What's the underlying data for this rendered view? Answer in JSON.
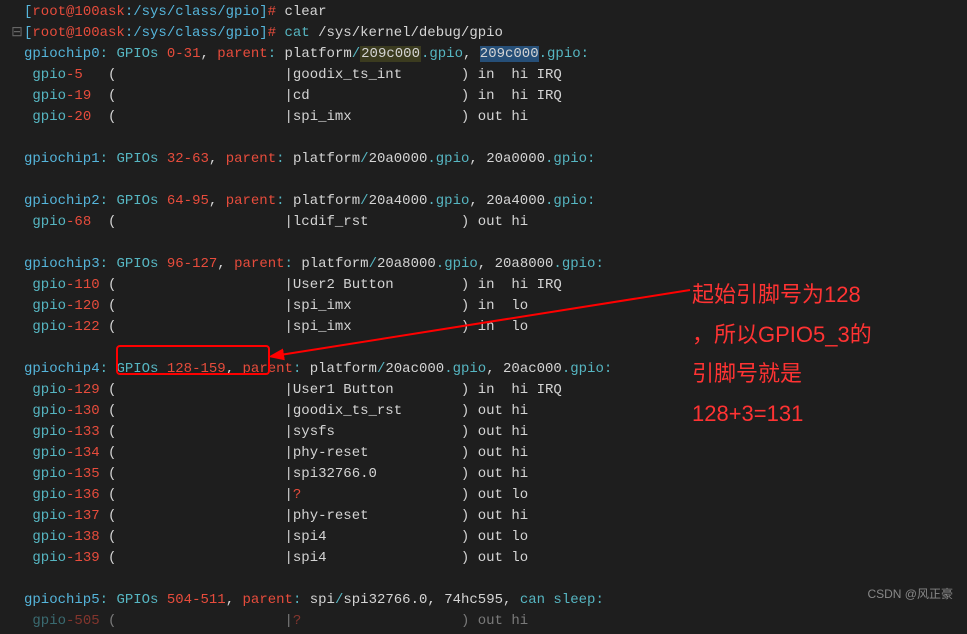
{
  "prompt": {
    "bracket_open": "[",
    "user_host": "root@100ask",
    "path": ":/sys/class/gpio",
    "bracket_close": "]",
    "hash": "#"
  },
  "cmds": {
    "clear": "clear",
    "cat": "cat",
    "cat_arg": "/sys/kernel/debug/gpio"
  },
  "chips": [
    {
      "name": "gpiochip0",
      "range_a": "0",
      "range_b": "31",
      "addr": "209c000",
      "addr2": "209c000",
      "lines": [
        {
          "n": "5",
          "label": "goodix_ts_int",
          "dir": "in",
          "lvl": "hi",
          "irq": "IRQ"
        },
        {
          "n": "19",
          "label": "cd",
          "dir": "in",
          "lvl": "hi",
          "irq": "IRQ"
        },
        {
          "n": "20",
          "label": "spi_imx",
          "dir": "out",
          "lvl": "hi",
          "irq": ""
        }
      ]
    },
    {
      "name": "gpiochip1",
      "range_a": "32",
      "range_b": "63",
      "addr": "20a0000",
      "addr2": "20a0000",
      "lines": []
    },
    {
      "name": "gpiochip2",
      "range_a": "64",
      "range_b": "95",
      "addr": "20a4000",
      "addr2": "20a4000",
      "lines": [
        {
          "n": "68",
          "label": "lcdif_rst",
          "dir": "out",
          "lvl": "hi",
          "irq": ""
        }
      ]
    },
    {
      "name": "gpiochip3",
      "range_a": "96",
      "range_b": "127",
      "addr": "20a8000",
      "addr2": "20a8000",
      "lines": [
        {
          "n": "110",
          "label": "User2 Button",
          "dir": "in",
          "lvl": "hi",
          "irq": "IRQ"
        },
        {
          "n": "120",
          "label": "spi_imx",
          "dir": "in",
          "lvl": "lo",
          "irq": ""
        },
        {
          "n": "122",
          "label": "spi_imx",
          "dir": "in",
          "lvl": "lo",
          "irq": ""
        }
      ]
    },
    {
      "name": "gpiochip4",
      "range_a": "128",
      "range_b": "159",
      "addr": "20ac000",
      "addr2": "20ac000",
      "lines": [
        {
          "n": "129",
          "label": "User1 Button",
          "dir": "in",
          "lvl": "hi",
          "irq": "IRQ"
        },
        {
          "n": "130",
          "label": "goodix_ts_rst",
          "dir": "out",
          "lvl": "hi",
          "irq": ""
        },
        {
          "n": "133",
          "label": "sysfs",
          "dir": "out",
          "lvl": "hi",
          "irq": ""
        },
        {
          "n": "134",
          "label": "phy-reset",
          "dir": "out",
          "lvl": "hi",
          "irq": ""
        },
        {
          "n": "135",
          "label": "spi32766.0",
          "dir": "out",
          "lvl": "hi",
          "irq": ""
        },
        {
          "n": "136",
          "label": "?",
          "dir": "out",
          "lvl": "lo",
          "irq": "",
          "q": true
        },
        {
          "n": "137",
          "label": "phy-reset",
          "dir": "out",
          "lvl": "hi",
          "irq": ""
        },
        {
          "n": "138",
          "label": "spi4",
          "dir": "out",
          "lvl": "lo",
          "irq": ""
        },
        {
          "n": "139",
          "label": "spi4",
          "dir": "out",
          "lvl": "lo",
          "irq": ""
        }
      ]
    }
  ],
  "chip5": {
    "name": "gpiochip5",
    "range_a": "504",
    "range_b": "511",
    "bus": "spi",
    "dev": "spi32766.0",
    "chip": "74hc595",
    "sleep": "can sleep",
    "line": {
      "n": "505",
      "label": "?",
      "dir": "out",
      "lvl": "hi"
    }
  },
  "annotation": {
    "l1": "起始引脚号为128",
    "l2": "，所以GPIO5_3的",
    "l3": "引脚号就是",
    "l4": "128+3=131"
  },
  "watermark": "CSDN @风正豪"
}
